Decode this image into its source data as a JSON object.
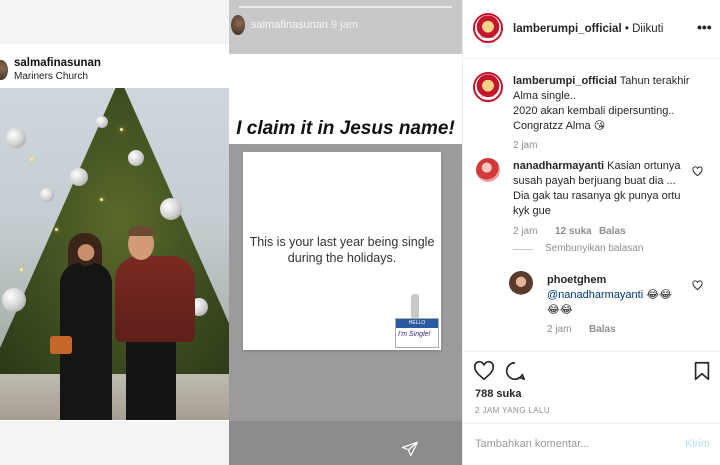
{
  "story_left": {
    "username": "salmafinasunan",
    "location": "Mariners Church"
  },
  "story_mid": {
    "username": "salmafinasunan",
    "time": "9 jam",
    "caption": "I claim it in Jesus name!",
    "meme_text_line1": "This is your last year being single",
    "meme_text_line2": "during the holidays.",
    "nametag_label": "HELLO",
    "nametag_text": "I'm Single!"
  },
  "post": {
    "author": "lamberumpi_official",
    "separator": "•",
    "follow_status": "Diikuti",
    "avatar_text": "LAMBE RUMPI"
  },
  "comments": [
    {
      "user": "lamberumpi_official",
      "lines": [
        "Tahun terakhir",
        "Alma single..",
        "2020 akan kembali dipersunting..",
        "Congratzz Alma 😘"
      ],
      "time": "2 jam"
    },
    {
      "user": "nanadharmayanti",
      "lines": [
        "Kasian ortunya",
        "susah payah berjuang buat dia ...",
        "Dia gak tau rasanya gk punya ortu",
        "kyk gue"
      ],
      "time": "2 jam",
      "likes": "12 suka",
      "reply": "Balas",
      "hide_replies": "Sembunyikan balasan"
    },
    {
      "user": "phoetghem",
      "mention": "@nanadharmayanti",
      "emoji_line1": "😂😂",
      "emoji_line2": "😂😂",
      "time": "2 jam",
      "reply": "Balas"
    }
  ],
  "actions": {
    "likes": "788 suka",
    "time_ago": "2 JAM YANG LALU"
  },
  "add_comment": {
    "placeholder": "Tambahkan komentar...",
    "post_label": "Kirim"
  },
  "colors": {
    "brand_red": "#c4172e",
    "link_blue": "#00376b",
    "muted_gray": "#8e8e8e",
    "post_button_disabled": "#b3dbff"
  }
}
